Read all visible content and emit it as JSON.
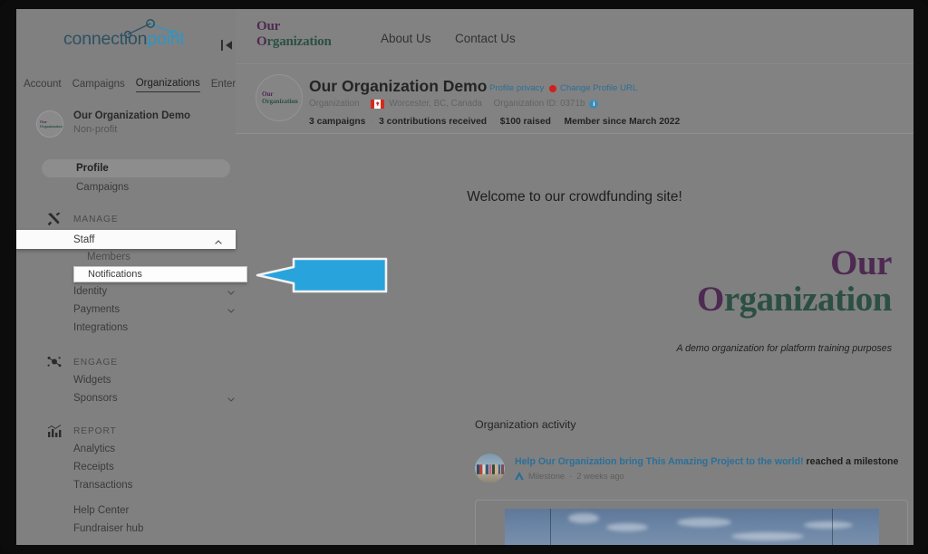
{
  "sidebar": {
    "brand": {
      "dark_text": "connection",
      "light_text": "point",
      "dark_color": "#2b5163",
      "light_color": "#2e95c4"
    },
    "collapse_icon": "collapse-left-icon",
    "top_tabs": [
      {
        "label": "Account",
        "active": false
      },
      {
        "label": "Campaigns",
        "active": false
      },
      {
        "label": "Organizations",
        "active": true
      },
      {
        "label": "Enterprise",
        "active": false
      }
    ],
    "org_card": {
      "name": "Our Organization Demo",
      "type": "Non-profit",
      "avatar_line1": "Our",
      "avatar_line2": "Organization"
    },
    "primary_nav": [
      {
        "label": "Profile",
        "selected": true
      },
      {
        "label": "Campaigns",
        "selected": false
      }
    ],
    "sections": [
      {
        "label": "MANAGE",
        "icon": "tools-icon",
        "items": [
          {
            "label": "Staff",
            "expanded": true,
            "highlighted": true,
            "chevron": "chevron-up-icon"
          },
          {
            "label": "Members",
            "indent": true
          },
          {
            "label": "Notifications",
            "indent": true,
            "boxed": true
          },
          {
            "label": "Identity",
            "chevron": "chevron-down-icon"
          },
          {
            "label": "Payments",
            "chevron": "chevron-down-icon"
          },
          {
            "label": "Integrations"
          }
        ]
      },
      {
        "label": "ENGAGE",
        "icon": "network-icon",
        "items": [
          {
            "label": "Widgets"
          },
          {
            "label": "Sponsors",
            "chevron": "chevron-down-icon"
          }
        ]
      },
      {
        "label": "REPORT",
        "icon": "bar-chart-icon",
        "items": [
          {
            "label": "Analytics"
          },
          {
            "label": "Receipts"
          },
          {
            "label": "Transactions"
          }
        ]
      }
    ],
    "footer_links": [
      {
        "label": "Help Center"
      },
      {
        "label": "Fundraiser hub"
      }
    ]
  },
  "site_header": {
    "logo_line1": "Our",
    "logo_line2": "Organization",
    "logo_purple": "#4e2a52",
    "logo_green": "#2c4f44",
    "nav": [
      {
        "label": "About Us"
      },
      {
        "label": "Contact Us"
      }
    ]
  },
  "org_strip": {
    "title": "Our Organization Demo",
    "privacy_link": "Profile privacy",
    "separator": "·",
    "change_url_link": "Change Profile URL",
    "change_url_dot_color": "#d0201e",
    "entity_type": "Organization",
    "country_flag": "canada-flag-icon",
    "location": "Worcester, BC, Canada",
    "org_id_label": "Organization ID: 0371b",
    "info_icon": "info-icon",
    "stats": [
      "3 campaigns",
      "3 contributions received",
      "$100 raised",
      "Member since March 2022"
    ]
  },
  "page_body": {
    "welcome": "Welcome to our crowdfunding site!",
    "hero_line1": "Our",
    "hero_line2_first": "O",
    "hero_line2_rest": "rganization",
    "hero_tagline": "A demo organization for platform training purposes",
    "activity_title": "Organization activity",
    "activity": {
      "link_text": "Help Our Organization bring This Amazing Project to the world!",
      "tail_text": " reached a milestone",
      "badge": "Milestone",
      "time": "2 weeks ago",
      "separator": "·"
    }
  },
  "annotation": {
    "arrow": "left-arrow-annotation",
    "arrow_fill": "#29a3dc",
    "arrow_stroke": "#ffffff",
    "points_to": "Notifications"
  }
}
